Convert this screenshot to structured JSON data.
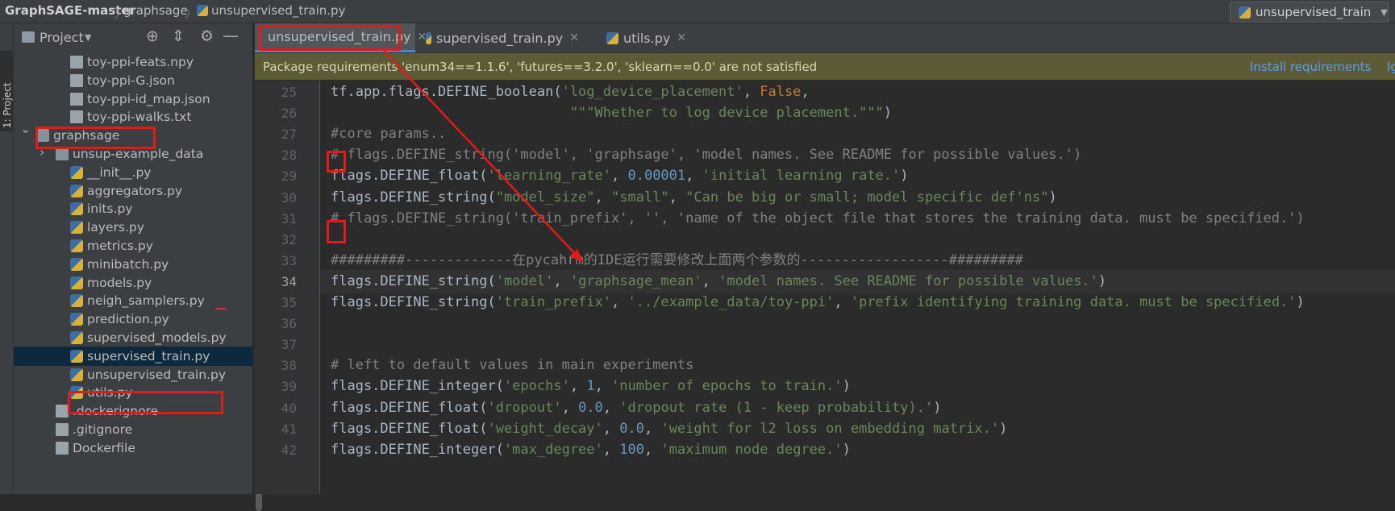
{
  "breadcrumb": {
    "root": "GraphSAGE-master",
    "folder": "graphsage",
    "file": "unsupervised_train.py"
  },
  "run_config": {
    "label": "unsupervised_train"
  },
  "tool_window_stripe": {
    "label": "1: Project"
  },
  "project_panel": {
    "title": "Project",
    "items": [
      {
        "label": "toy-ppi-feats.npy",
        "type": "file",
        "indent": 3
      },
      {
        "label": "toy-ppi-G.json",
        "type": "file",
        "indent": 3
      },
      {
        "label": "toy-ppi-id_map.json",
        "type": "file",
        "indent": 3
      },
      {
        "label": "toy-ppi-walks.txt",
        "type": "file",
        "indent": 3
      },
      {
        "label": "graphsage",
        "type": "folder",
        "expanded": true,
        "indent": 1,
        "highlighted": true
      },
      {
        "label": "unsup-example_data",
        "type": "folder",
        "indent": 2
      },
      {
        "label": "__init__.py",
        "type": "py",
        "indent": 3
      },
      {
        "label": "aggregators.py",
        "type": "py",
        "indent": 3
      },
      {
        "label": "inits.py",
        "type": "py",
        "indent": 3
      },
      {
        "label": "layers.py",
        "type": "py",
        "indent": 3
      },
      {
        "label": "metrics.py",
        "type": "py",
        "indent": 3
      },
      {
        "label": "minibatch.py",
        "type": "py",
        "indent": 3
      },
      {
        "label": "models.py",
        "type": "py",
        "indent": 3
      },
      {
        "label": "neigh_samplers.py",
        "type": "py",
        "indent": 3
      },
      {
        "label": "prediction.py",
        "type": "py",
        "indent": 3
      },
      {
        "label": "supervised_models.py",
        "type": "py",
        "indent": 3
      },
      {
        "label": "supervised_train.py",
        "type": "py",
        "indent": 3,
        "selected": true
      },
      {
        "label": "unsupervised_train.py",
        "type": "py",
        "indent": 3,
        "highlighted": true
      },
      {
        "label": "utils.py",
        "type": "py",
        "indent": 3
      },
      {
        "label": ".dockerignore",
        "type": "file",
        "indent": 2
      },
      {
        "label": ".gitignore",
        "type": "file",
        "indent": 2
      },
      {
        "label": "Dockerfile",
        "type": "file",
        "indent": 2
      }
    ]
  },
  "tabs": [
    {
      "label": "unsupervised_train.py",
      "active": true
    },
    {
      "label": "supervised_train.py",
      "active": false
    },
    {
      "label": "utils.py",
      "active": false
    }
  ],
  "banner": {
    "message": "Package requirements 'enum34==1.1.6', 'futures==3.2.0', 'sklearn==0.0' are not satisfied",
    "action": "Install requirements",
    "extra": "Ig"
  },
  "editor": {
    "lines": [
      {
        "n": "25",
        "text": "tf.app.flags.DEFINE_boolean('log_device_placement', False,"
      },
      {
        "n": "26",
        "text": "                             \"\"\"Whether to log device placement.\"\"\")"
      },
      {
        "n": "27",
        "text": "#core params.."
      },
      {
        "n": "28",
        "text": "# flags.DEFINE_string('model', 'graphsage', 'model names. See README for possible values.')"
      },
      {
        "n": "29",
        "text": "flags.DEFINE_float('learning_rate', 0.00001, 'initial learning rate.')"
      },
      {
        "n": "30",
        "text": "flags.DEFINE_string(\"model_size\", \"small\", \"Can be big or small; model specific def'ns\")"
      },
      {
        "n": "31",
        "text": "# flags.DEFINE_string('train_prefix', '', 'name of the object file that stores the training data. must be specified.')"
      },
      {
        "n": "32",
        "text": ""
      },
      {
        "n": "33",
        "text": "#########-------------在pycahrm的IDE运行需要修改上面两个参数的------------------#########"
      },
      {
        "n": "34",
        "text": "flags.DEFINE_string('model', 'graphsage_mean', 'model names. See README for possible values.')"
      },
      {
        "n": "35",
        "text": "flags.DEFINE_string('train_prefix', '../example_data/toy-ppi', 'prefix identifying training data. must be specified.')"
      },
      {
        "n": "36",
        "text": ""
      },
      {
        "n": "37",
        "text": ""
      },
      {
        "n": "38",
        "text": "# left to default values in main experiments"
      },
      {
        "n": "39",
        "text": "flags.DEFINE_integer('epochs', 1, 'number of epochs to train.')"
      },
      {
        "n": "40",
        "text": "flags.DEFINE_float('dropout', 0.0, 'dropout rate (1 - keep probability).')"
      },
      {
        "n": "41",
        "text": "flags.DEFINE_float('weight_decay', 0.0, 'weight for l2 loss on embedding matrix.')"
      },
      {
        "n": "42",
        "text": "flags.DEFINE_integer('max_degree', 100, 'maximum node degree.')"
      }
    ],
    "current_line": "34"
  },
  "colors": {
    "annotation": "#e01b1b",
    "string": "#6a8759",
    "keyword": "#cc7832",
    "number": "#6897bb",
    "comment": "#808080"
  }
}
